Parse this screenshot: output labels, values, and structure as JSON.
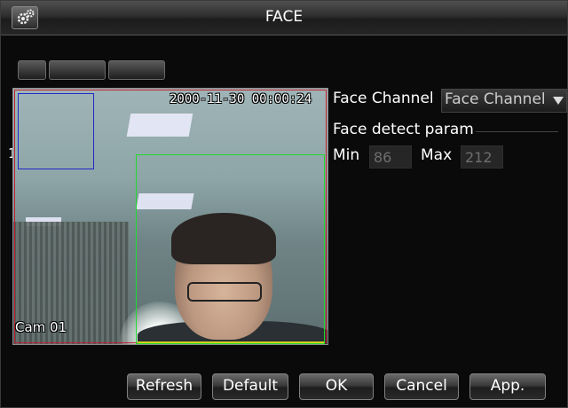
{
  "window": {
    "title": "FACE"
  },
  "preview": {
    "timestamp": "2000-11-30 00:00:24",
    "camera_label": "Cam 01",
    "side_number": "1"
  },
  "settings": {
    "face_channel_label": "Face Channel",
    "face_channel_value": "Face Channel",
    "face_detect_param_label": "Face detect param",
    "min_label": "Min",
    "min_value": "86",
    "max_label": "Max",
    "max_value": "212"
  },
  "buttons": {
    "refresh": "Refresh",
    "default": "Default",
    "ok": "OK",
    "cancel": "Cancel",
    "apply": "App."
  },
  "colors": {
    "region_blue": "#2028c8",
    "region_green": "#1fdc2a",
    "region_red": "#c02030",
    "region_yellow": "#d8d020"
  },
  "icons": {
    "settings": "gear-icon",
    "dropdown": "chevron-down-icon"
  }
}
